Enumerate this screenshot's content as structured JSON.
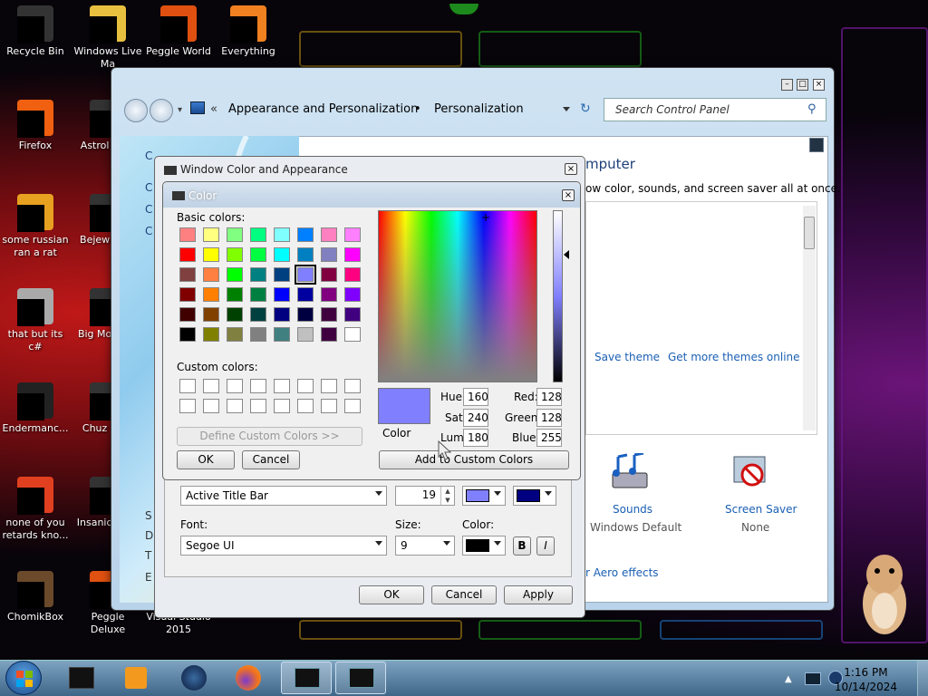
{
  "desktop_icons": [
    {
      "label": "Recycle Bin"
    },
    {
      "label": "Windows Live Ma"
    },
    {
      "label": "Peggle World"
    },
    {
      "label": "Everything"
    },
    {
      "label": "Firefox"
    },
    {
      "label": "Astrol Delu"
    },
    {
      "label": "some russian ran a rat"
    },
    {
      "label": "Bejew Delu"
    },
    {
      "label": "that but its c#"
    },
    {
      "label": "Big Mo Delu"
    },
    {
      "label": "Endermanc..."
    },
    {
      "label": "Chuz Delu"
    },
    {
      "label": "none of you retards kno..."
    },
    {
      "label": "Insaniq Delu"
    },
    {
      "label": "ChomikBox"
    },
    {
      "label": "Peggle Deluxe"
    },
    {
      "label": "Visual Studio 2015"
    }
  ],
  "control_panel": {
    "breadcrumb_sep": "«",
    "crumb1": "Appearance and Personalization",
    "crumb_dot": "•",
    "crumb2": "Personalization",
    "search_placeholder": "Search Control Panel",
    "heading": "mputer",
    "subtitle": "ow color, sounds, and screen saver all at once.",
    "save_theme": "Save theme",
    "get_more_themes": "Get more themes online",
    "sounds_label": "Sounds",
    "sounds_value": "Windows Default",
    "screensaver_label": "Screen Saver",
    "screensaver_value": "None",
    "aero_link": "r Aero effects",
    "left_letters": [
      "C",
      "C",
      "C",
      "C"
    ],
    "left_bottom": [
      "S",
      "D",
      "T",
      "E"
    ]
  },
  "wca_dialog": {
    "title": "Window Color and Appearance",
    "item_value": "Active Title Bar",
    "size_value": "19",
    "font_label": "Font:",
    "size_label": "Size:",
    "color_label": "Color:",
    "font_value": "Segoe UI",
    "font_size_value": "9",
    "bold": "B",
    "italic": "I",
    "ok": "OK",
    "cancel": "Cancel",
    "apply": "Apply",
    "color1": "#8080ff",
    "color2": "#000080",
    "font_color": "#000000"
  },
  "color_dialog": {
    "title": "Color",
    "basic_colors_label": "Basic colors:",
    "custom_colors_label": "Custom colors:",
    "define_custom": "Define Custom Colors >>",
    "ok": "OK",
    "cancel": "Cancel",
    "add_custom": "Add to Custom Colors",
    "color_solid_label": "Color",
    "hue_label": "Hue:",
    "hue": "160",
    "sat_label": "Sat:",
    "sat": "240",
    "lum_label": "Lum:",
    "lum": "180",
    "red_label": "Red:",
    "red": "128",
    "green_label": "Green:",
    "green": "128",
    "blue_label": "Blue:",
    "blue": "255",
    "selected_color": "#8080ff",
    "basic_colors": [
      "#ff8080",
      "#ffff80",
      "#80ff80",
      "#00ff80",
      "#80ffff",
      "#0080ff",
      "#ff80c0",
      "#ff80ff",
      "#ff0000",
      "#ffff00",
      "#80ff00",
      "#00ff40",
      "#00ffff",
      "#0080c0",
      "#8080c0",
      "#ff00ff",
      "#804040",
      "#ff8040",
      "#00ff00",
      "#008080",
      "#004080",
      "#8080ff",
      "#800040",
      "#ff0080",
      "#800000",
      "#ff8000",
      "#008000",
      "#008040",
      "#0000ff",
      "#0000a0",
      "#800080",
      "#8000ff",
      "#400000",
      "#804000",
      "#004000",
      "#004040",
      "#000080",
      "#000040",
      "#400040",
      "#400080",
      "#000000",
      "#808000",
      "#808040",
      "#808080",
      "#408080",
      "#c0c0c0",
      "#400040",
      "#ffffff"
    ]
  },
  "taskbar": {
    "time": "1:16 PM",
    "date": "10/14/2024"
  }
}
